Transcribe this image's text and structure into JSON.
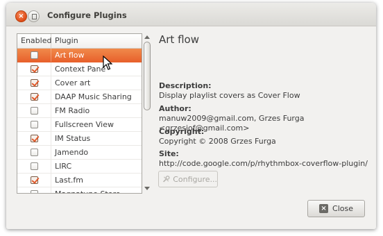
{
  "window": {
    "title": "Configure Plugins"
  },
  "list": {
    "headers": {
      "enabled": "Enabled",
      "plugin": "Plugin"
    },
    "rows": [
      {
        "name": "Art flow",
        "enabled": false,
        "selected": true
      },
      {
        "name": "Context Pane",
        "enabled": true,
        "selected": false
      },
      {
        "name": "Cover art",
        "enabled": true,
        "selected": false
      },
      {
        "name": "DAAP Music Sharing",
        "enabled": true,
        "selected": false
      },
      {
        "name": "FM Radio",
        "enabled": false,
        "selected": false
      },
      {
        "name": "Fullscreen View",
        "enabled": false,
        "selected": false
      },
      {
        "name": "IM Status",
        "enabled": true,
        "selected": false
      },
      {
        "name": "Jamendo",
        "enabled": false,
        "selected": false
      },
      {
        "name": "LIRC",
        "enabled": false,
        "selected": false
      },
      {
        "name": "Last.fm",
        "enabled": true,
        "selected": false
      },
      {
        "name": "Magnatune Store",
        "enabled": false,
        "selected": false
      }
    ]
  },
  "details": {
    "title": "Art flow",
    "description_label": "Description:",
    "description": "Display playlist covers as Cover Flow",
    "author_label": "Author:",
    "author": "manuw2009@gmail.com, Grzes Furga <grzesiof@gmail.com>",
    "copyright_label": "Copyright:",
    "copyright": "Copyright © 2008 Grzes Furga",
    "site_label": "Site:",
    "site": "http://code.google.com/p/rhythmbox-coverflow-plugin/"
  },
  "buttons": {
    "configure": "Configure...",
    "close": "Close"
  },
  "colors": {
    "selection": "#e8612c",
    "window_bg": "#f2f1ef"
  }
}
